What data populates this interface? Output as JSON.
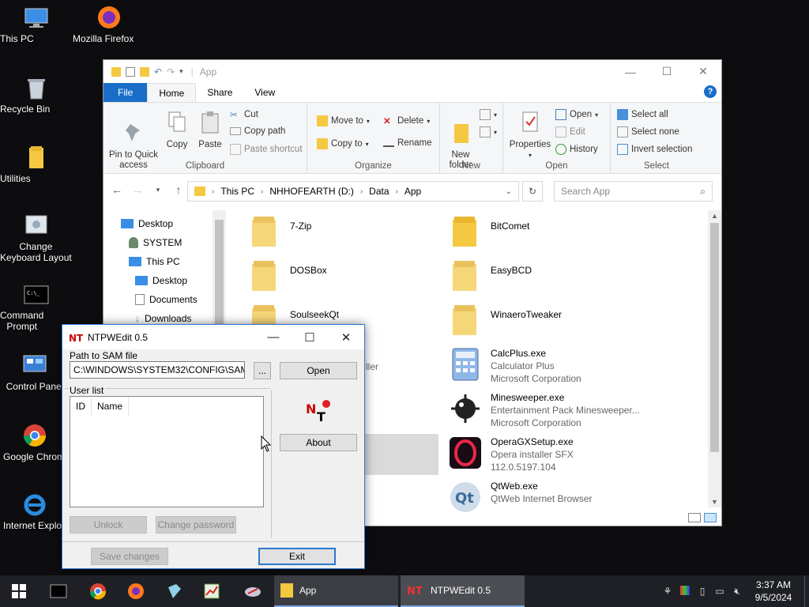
{
  "desktop": {
    "icons": [
      {
        "label": "This PC"
      },
      {
        "label": "Mozilla Firefox"
      },
      {
        "label": "Recycle Bin"
      },
      {
        "label": "Utilities"
      },
      {
        "label": "Change\nKeyboard Layout"
      },
      {
        "label": "Command\nPrompt"
      },
      {
        "label": "Control Panel"
      },
      {
        "label": "Google Chrome"
      },
      {
        "label": "Internet Explorer"
      }
    ]
  },
  "explorer": {
    "title": "App",
    "tabs": [
      "File",
      "Home",
      "Share",
      "View"
    ],
    "ribbon": {
      "clipboard": {
        "name": "Clipboard",
        "pin": "Pin to Quick\naccess",
        "copy": "Copy",
        "paste": "Paste",
        "cut": "Cut",
        "copy_path": "Copy path",
        "paste_shortcut": "Paste shortcut"
      },
      "organize": {
        "name": "Organize",
        "move_to": "Move to",
        "copy_to": "Copy to",
        "delete": "Delete",
        "rename": "Rename"
      },
      "new": {
        "name": "New",
        "new_folder": "New\nfolder"
      },
      "open": {
        "name": "Open",
        "properties": "Properties",
        "open": "Open",
        "edit": "Edit",
        "history": "History"
      },
      "select": {
        "name": "Select",
        "select_all": "Select all",
        "select_none": "Select none",
        "invert": "Invert selection"
      }
    },
    "address": {
      "crumbs": [
        "This PC",
        "NHHOFEARTH (D:)",
        "Data",
        "App"
      ]
    },
    "search_placeholder": "Search App",
    "nav": [
      "Desktop",
      "SYSTEM",
      "This PC",
      "Desktop",
      "Documents",
      "Downloads"
    ],
    "files": [
      {
        "name": "7-Zip"
      },
      {
        "name": "BitComet"
      },
      {
        "name": "DOSBox"
      },
      {
        "name": "EasyBCD"
      },
      {
        "name": "SoulseekQt"
      },
      {
        "name": "WinaeroTweaker"
      },
      {
        "name": "CalcPlus.exe",
        "desc": "Calculator Plus",
        "company": "Microsoft Corporation"
      },
      {
        "name": "Minesweeper.exe",
        "desc": "Entertainment Pack Minesweeper...",
        "company": "Microsoft Corporation"
      },
      {
        "name": "OperaGXSetup.exe",
        "desc": "Opera installer SFX",
        "company": "112.0.5197.104"
      },
      {
        "name": "QtWeb.exe",
        "desc": "QtWeb Internet Browser",
        "company": ""
      }
    ],
    "partial_label": "ller"
  },
  "dialog": {
    "title": "NTPWEdit 0.5",
    "path_label": "Path to SAM file",
    "path_value": "C:\\WINDOWS\\SYSTEM32\\CONFIG\\SAM",
    "browse": "...",
    "open": "Open",
    "user_list_label": "User list",
    "columns": [
      "ID",
      "Name"
    ],
    "about": "About",
    "unlock": "Unlock",
    "change_password": "Change password",
    "save_changes": "Save changes",
    "exit": "Exit"
  },
  "taskbar": {
    "apps": [
      "App",
      "NTPWEdit 0.5"
    ],
    "time": "3:37 AM",
    "date": "9/5/2024"
  }
}
